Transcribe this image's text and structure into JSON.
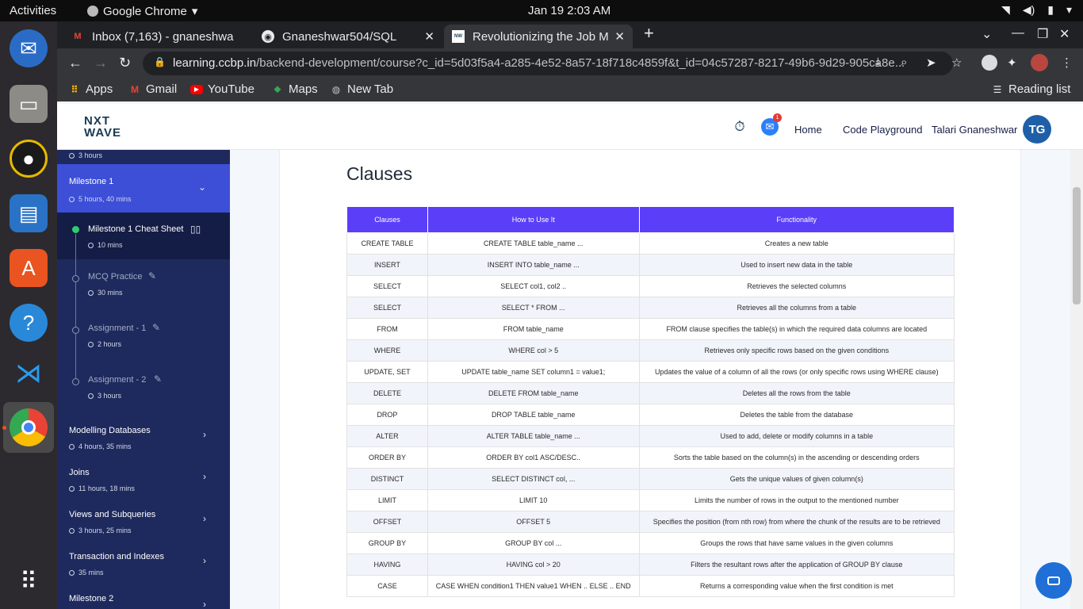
{
  "topbar": {
    "activities": "Activities",
    "app_name": "Google Chrome",
    "clock": "Jan 19  2:03 AM"
  },
  "chrome": {
    "tabs": [
      {
        "title": "Inbox (7,163) - gnaneshwa",
        "favicon": "gmail-icon"
      },
      {
        "title": "Gnaneshwar504/SQL",
        "favicon": "github-icon"
      },
      {
        "title": "Revolutionizing the Job M",
        "favicon": "nxtwave-icon"
      }
    ],
    "url_host": "learning.ccbp.in",
    "url_path": "/backend-development/course?c_id=5d03f5a4-a285-4e52-8a57-18f718c4859f&t_id=04c57287-8217-49b6-9d29-905ca8e...",
    "bookmarks": [
      {
        "label": "Apps",
        "icon": "apps-grid-icon",
        "color": "#f4b400"
      },
      {
        "label": "Gmail",
        "icon": "gmail-icon",
        "color": "#ea4335"
      },
      {
        "label": "YouTube",
        "icon": "youtube-icon",
        "color": "#ff0000"
      },
      {
        "label": "Maps",
        "icon": "maps-icon",
        "color": "#34a853"
      },
      {
        "label": "New Tab",
        "icon": "globe-icon",
        "color": "#bdc1c6"
      }
    ],
    "reading_list": "Reading list"
  },
  "header": {
    "logo_line1": "NXT",
    "logo_line2": "WAVE",
    "notification_count": "1",
    "home": "Home",
    "code_playground": "Code Playground",
    "user_name": "Talari Gnaneshwar",
    "avatar_initials": "TG"
  },
  "sidebar": {
    "top_time": "3 hours",
    "milestone1": {
      "name": "Milestone 1",
      "time": "5 hours, 40 mins"
    },
    "items": [
      {
        "name": "Milestone 1 Cheat Sheet",
        "time": "10 mins"
      },
      {
        "name": "MCQ Practice",
        "time": "30 mins"
      },
      {
        "name": "Assignment - 1",
        "time": "2 hours"
      },
      {
        "name": "Assignment - 2",
        "time": "3 hours"
      }
    ],
    "sections": [
      {
        "name": "Modelling Databases",
        "time": "4 hours, 35 mins"
      },
      {
        "name": "Joins",
        "time": "11 hours, 18 mins"
      },
      {
        "name": "Views and Subqueries",
        "time": "3 hours, 25 mins"
      },
      {
        "name": "Transaction and Indexes",
        "time": "35 mins"
      },
      {
        "name": "Milestone 2",
        "time": ""
      }
    ]
  },
  "content": {
    "title": "Clauses",
    "columns": [
      "Clauses",
      "How to Use It",
      "Functionality"
    ],
    "rows": [
      [
        "CREATE TABLE",
        "CREATE TABLE table_name ...",
        "Creates a new table"
      ],
      [
        "INSERT",
        "INSERT INTO table_name ...",
        "Used to insert new data in the table"
      ],
      [
        "SELECT",
        "SELECT col1, col2 ..",
        "Retrieves the selected columns"
      ],
      [
        "SELECT",
        "SELECT * FROM ...",
        "Retrieves all the columns from a table"
      ],
      [
        "FROM",
        "FROM table_name",
        "FROM clause specifies the table(s) in which the required data columns are located"
      ],
      [
        "WHERE",
        "WHERE col > 5",
        "Retrieves only specific rows based on the given conditions"
      ],
      [
        "UPDATE, SET",
        "UPDATE table_name SET column1 = value1;",
        "Updates the value of a column of all the rows (or only specific rows using WHERE clause)"
      ],
      [
        "DELETE",
        "DELETE FROM table_name",
        "Deletes all the rows from the table"
      ],
      [
        "DROP",
        "DROP TABLE table_name",
        "Deletes the table from the database"
      ],
      [
        "ALTER",
        "ALTER TABLE table_name ...",
        "Used to add, delete or modify columns in a table"
      ],
      [
        "ORDER BY",
        "ORDER BY col1 ASC/DESC..",
        "Sorts the table based on the column(s) in the ascending or descending orders"
      ],
      [
        "DISTINCT",
        "SELECT DISTINCT col, ...",
        "Gets the unique values of given column(s)"
      ],
      [
        "LIMIT",
        "LIMIT 10",
        "Limits the number of rows in the output to the mentioned number"
      ],
      [
        "OFFSET",
        "OFFSET 5",
        "Specifies the position (from nth row) from where the chunk of the results are to be retrieved"
      ],
      [
        "GROUP BY",
        "GROUP BY col ...",
        "Groups the rows that have same values in the given columns"
      ],
      [
        "HAVING",
        "HAVING col > 20",
        "Filters the resultant rows after the application of GROUP BY clause"
      ],
      [
        "CASE",
        "CASE WHEN condition1 THEN value1 WHEN .. ELSE .. END",
        "Returns a corresponding value when the first condition is met"
      ]
    ]
  },
  "colors": {
    "table_header": "#5b3ff8",
    "sidebar_bg": "#1e2a5e",
    "sidebar_active": "#3d4fd6",
    "avatar": "#1f5fa8",
    "check": "#2ecc71"
  }
}
